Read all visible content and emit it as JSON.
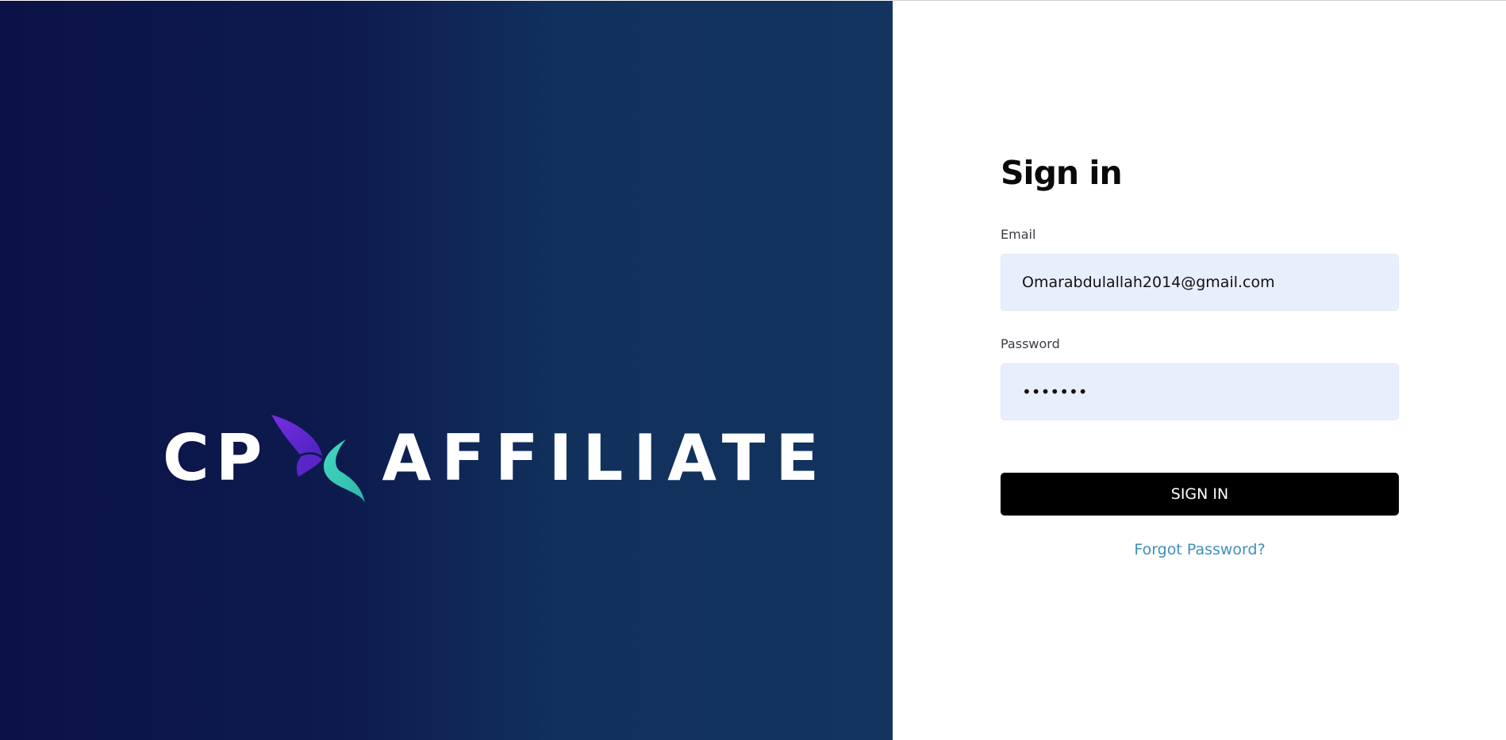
{
  "brand": {
    "name_left": "CP",
    "name_right": "AFFILIATE",
    "logo_icon": "butterfly-logo-icon",
    "background_colors": [
      "#0c1246",
      "#13345f"
    ]
  },
  "signin": {
    "title": "Sign in",
    "email": {
      "label": "Email",
      "value": "Omarabdulallah2014@gmail.com"
    },
    "password": {
      "label": "Password",
      "value": "•••••••"
    },
    "submit_label": "SIGN IN",
    "forgot_password_label": "Forgot Password?"
  },
  "colors": {
    "input_background": "#e8effc",
    "button_background": "#000000",
    "link": "#3f8fbd"
  }
}
